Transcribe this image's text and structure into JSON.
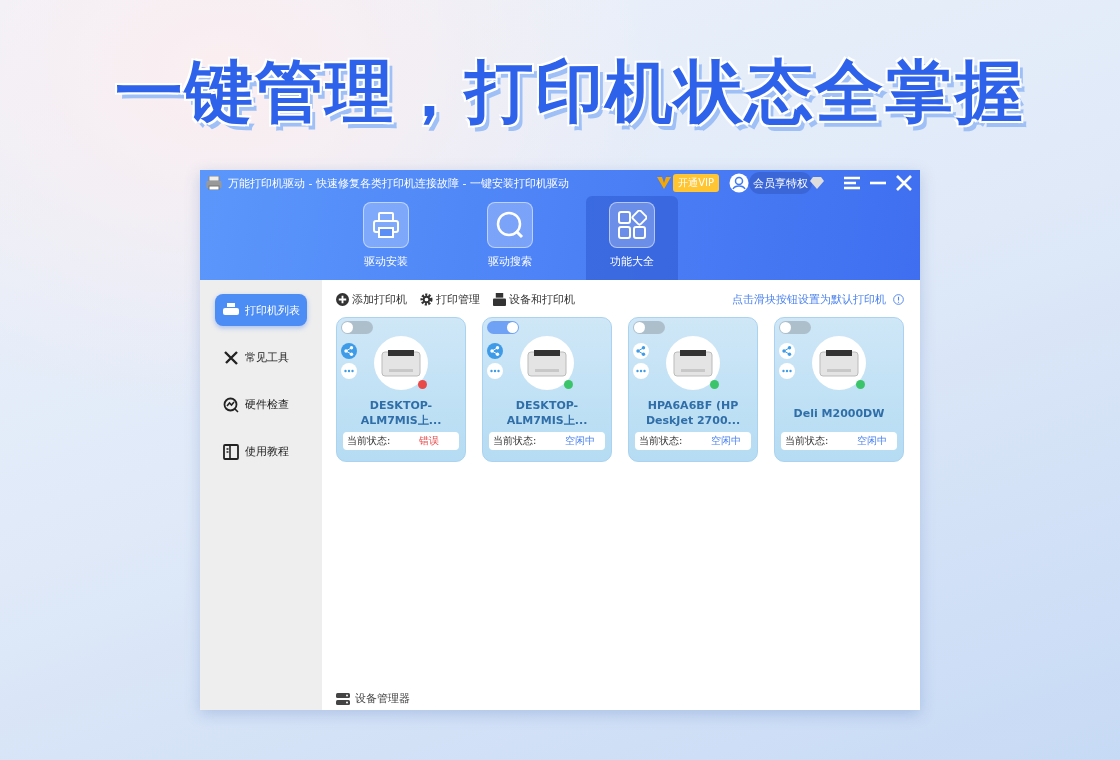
{
  "headline": "一键管理，打印机状态全掌握",
  "window": {
    "title": "万能打印机驱动 - 快速修复各类打印机连接故障 - 一键安装打印机驱动",
    "vip": "开通VIP",
    "member": "会员享特权"
  },
  "nav_tabs": [
    {
      "label": "驱动安装",
      "selected": false
    },
    {
      "label": "驱动搜索",
      "selected": false
    },
    {
      "label": "功能大全",
      "selected": true
    }
  ],
  "sidebar": {
    "items": [
      {
        "label": "打印机列表",
        "selected": true
      },
      {
        "label": "常见工具",
        "selected": false
      },
      {
        "label": "硬件检查",
        "selected": false
      },
      {
        "label": "使用教程",
        "selected": false
      }
    ]
  },
  "toolbar": [
    "添加打印机",
    "打印管理",
    "设备和打印机"
  ],
  "hint": "点击滑块按钮设置为默认打印机",
  "printers": [
    {
      "name": "DESKTOP-\nALM7MIS上...",
      "on": false,
      "shared": true,
      "color": "#e84a4a",
      "status_label": "当前状态:",
      "status": "错误",
      "error": true
    },
    {
      "name": "DESKTOP-\nALM7MIS上...",
      "on": true,
      "shared": true,
      "color": "#3cc46a",
      "status_label": "当前状态:",
      "status": "空闲中",
      "error": false
    },
    {
      "name": "HPA6A6BF (HP\nDeskJet 2700...",
      "on": false,
      "shared": false,
      "color": "#3cc46a",
      "status_label": "当前状态:",
      "status": "空闲中",
      "error": false
    },
    {
      "name": "Deli M2000DW",
      "on": false,
      "shared": false,
      "color": "#3cc46a",
      "status_label": "当前状态:",
      "status": "空闲中",
      "error": false
    }
  ],
  "footer": "设备管理器"
}
